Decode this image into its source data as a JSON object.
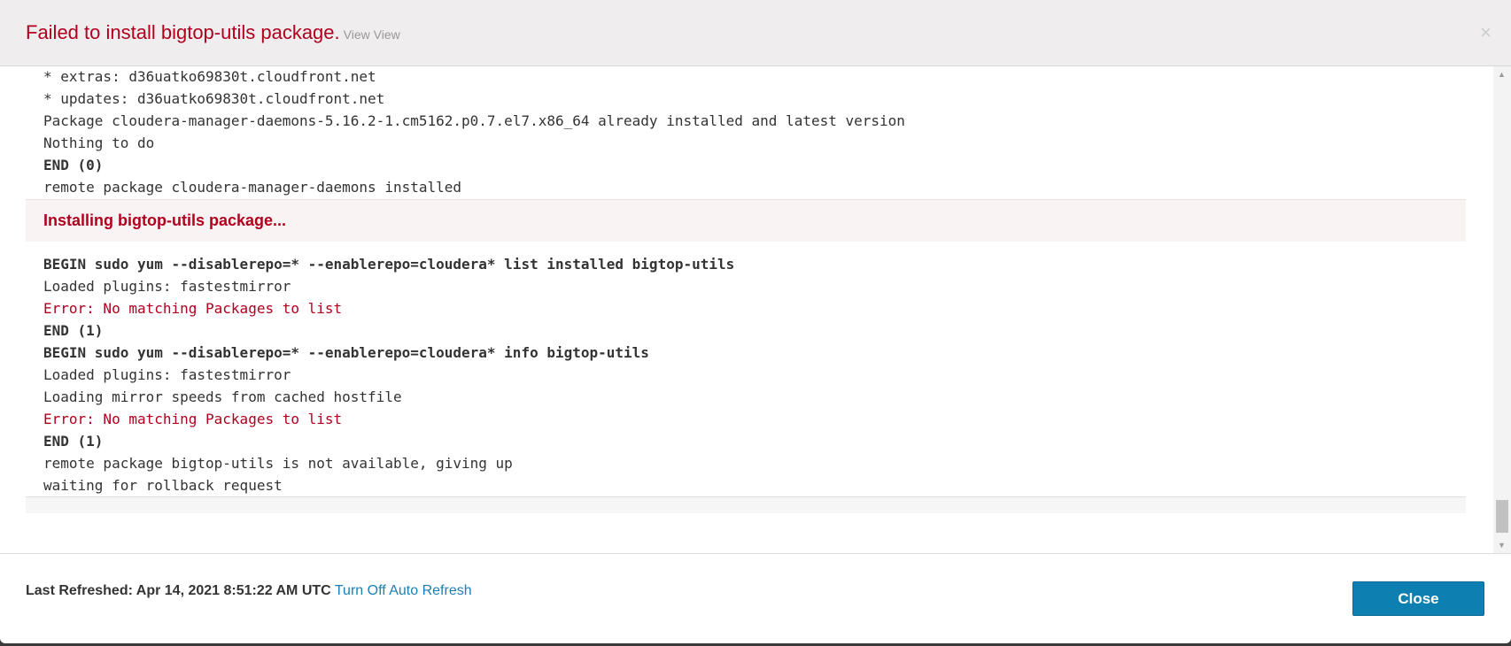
{
  "header": {
    "title": "Failed to install bigtop-utils package.",
    "subtitle": "View View",
    "close_icon": "×"
  },
  "log_top": [
    {
      "text": "* extras: d36uatko69830t.cloudfront.net",
      "style": ""
    },
    {
      "text": "* updates: d36uatko69830t.cloudfront.net",
      "style": ""
    },
    {
      "text": "Package cloudera-manager-daemons-5.16.2-1.cm5162.p0.7.el7.x86_64 already installed and latest version",
      "style": ""
    },
    {
      "text": "Nothing to do",
      "style": ""
    },
    {
      "text": "END (0)",
      "style": "b"
    },
    {
      "text": "remote package cloudera-manager-daemons installed",
      "style": ""
    }
  ],
  "section_title": "Installing bigtop-utils package...",
  "log_bottom": [
    {
      "text": "BEGIN sudo yum --disablerepo=* --enablerepo=cloudera* list installed bigtop-utils",
      "style": "b"
    },
    {
      "text": "Loaded plugins: fastestmirror",
      "style": ""
    },
    {
      "text": "Error: No matching Packages to list",
      "style": "err"
    },
    {
      "text": "END (1)",
      "style": "b"
    },
    {
      "text": "BEGIN sudo yum --disablerepo=* --enablerepo=cloudera* info bigtop-utils",
      "style": "b"
    },
    {
      "text": "Loaded plugins: fastestmirror",
      "style": ""
    },
    {
      "text": "Loading mirror speeds from cached hostfile",
      "style": ""
    },
    {
      "text": "Error: No matching Packages to list",
      "style": "err"
    },
    {
      "text": "END (1)",
      "style": "b"
    },
    {
      "text": "remote package bigtop-utils is not available, giving up",
      "style": ""
    },
    {
      "text": "waiting for rollback request",
      "style": ""
    }
  ],
  "footer": {
    "last_refreshed_label": "Last Refreshed: Apr 14, 2021 8:51:22 AM UTC",
    "auto_refresh_link": "Turn Off Auto Refresh",
    "close_label": "Close"
  }
}
